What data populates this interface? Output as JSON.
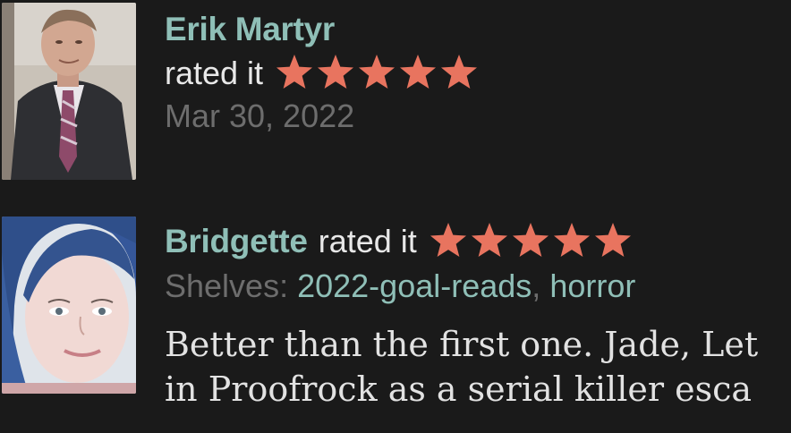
{
  "reviews": [
    {
      "user": "Erik Martyr",
      "rated_text": "rated it",
      "rating": 5,
      "max_rating": 5,
      "date": "Mar 30, 2022"
    },
    {
      "user": "Bridgette",
      "rated_text": "rated it",
      "rating": 5,
      "max_rating": 5,
      "shelves_label": "Shelves:",
      "shelves": [
        "2022-goal-reads",
        "horror"
      ],
      "shelves_separator": ",",
      "text_line_1": "Better than the first one. Jade, Let",
      "text_line_2": "in Proofrock as a serial killer esca"
    }
  ],
  "colors": {
    "background": "#1a1a1a",
    "link": "#8fbfb7",
    "star": "#e8745f",
    "muted": "#6d6d6d",
    "text": "#e8e8e8"
  },
  "icons": {
    "rating_star": "star-icon"
  }
}
